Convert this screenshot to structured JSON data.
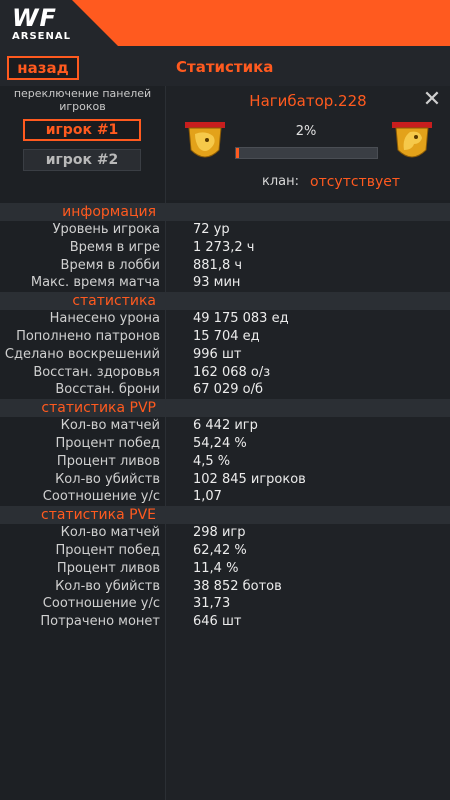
{
  "header": {
    "logo_main": "WF",
    "logo_sub": "ARSENAL",
    "accent_color": "#ff5a1f"
  },
  "topbar": {
    "back_label": "назад",
    "title": "Статистика"
  },
  "player_switch": {
    "label": "переключение панелей игроков",
    "buttons": [
      "игрок #1",
      "игрок #2"
    ],
    "active_index": 0
  },
  "profile": {
    "nickname": "Нагибатор.228",
    "progress_text": "2%",
    "progress_fraction": 0.02,
    "clan_label": "клан:",
    "clan_value": "отсутствует",
    "left_emblem_icon": "lion-emblem-icon",
    "right_emblem_icon": "horse-emblem-icon"
  },
  "sections": [
    {
      "title": "информация",
      "rows": [
        {
          "label": "Уровень игрока",
          "value": "72 ур"
        },
        {
          "label": "Время в игре",
          "value": "1 273,2 ч"
        },
        {
          "label": "Время в лобби",
          "value": "881,8 ч"
        },
        {
          "label": "Макс. время матча",
          "value": "93 мин"
        }
      ]
    },
    {
      "title": "статистика",
      "rows": [
        {
          "label": "Нанесено урона",
          "value": "49 175 083 ед"
        },
        {
          "label": "Пополнено патронов",
          "value": "15 704 ед"
        },
        {
          "label": "Сделано воскрешений",
          "value": "996 шт"
        },
        {
          "label": "Восстан. здоровья",
          "value": "162 068 о/з"
        },
        {
          "label": "Восстан. брони",
          "value": "67 029 о/б"
        }
      ]
    },
    {
      "title": "статистика PVP",
      "rows": [
        {
          "label": "Кол-во матчей",
          "value": "6 442 игр"
        },
        {
          "label": "Процент побед",
          "value": "54,24 %"
        },
        {
          "label": "Процент ливов",
          "value": "4,5 %"
        },
        {
          "label": "Кол-во убийств",
          "value": "102 845 игроков"
        },
        {
          "label": "Соотношение у/с",
          "value": "1,07"
        }
      ]
    },
    {
      "title": "статистика PVE",
      "rows": [
        {
          "label": "Кол-во матчей",
          "value": "298 игр"
        },
        {
          "label": "Процент побед",
          "value": "62,42 %"
        },
        {
          "label": "Процент ливов",
          "value": "11,4 %"
        },
        {
          "label": "Кол-во убийств",
          "value": "38 852 ботов"
        },
        {
          "label": "Соотношение у/с",
          "value": "31,73"
        },
        {
          "label": "Потрачено монет",
          "value": "646 шт"
        }
      ]
    }
  ]
}
